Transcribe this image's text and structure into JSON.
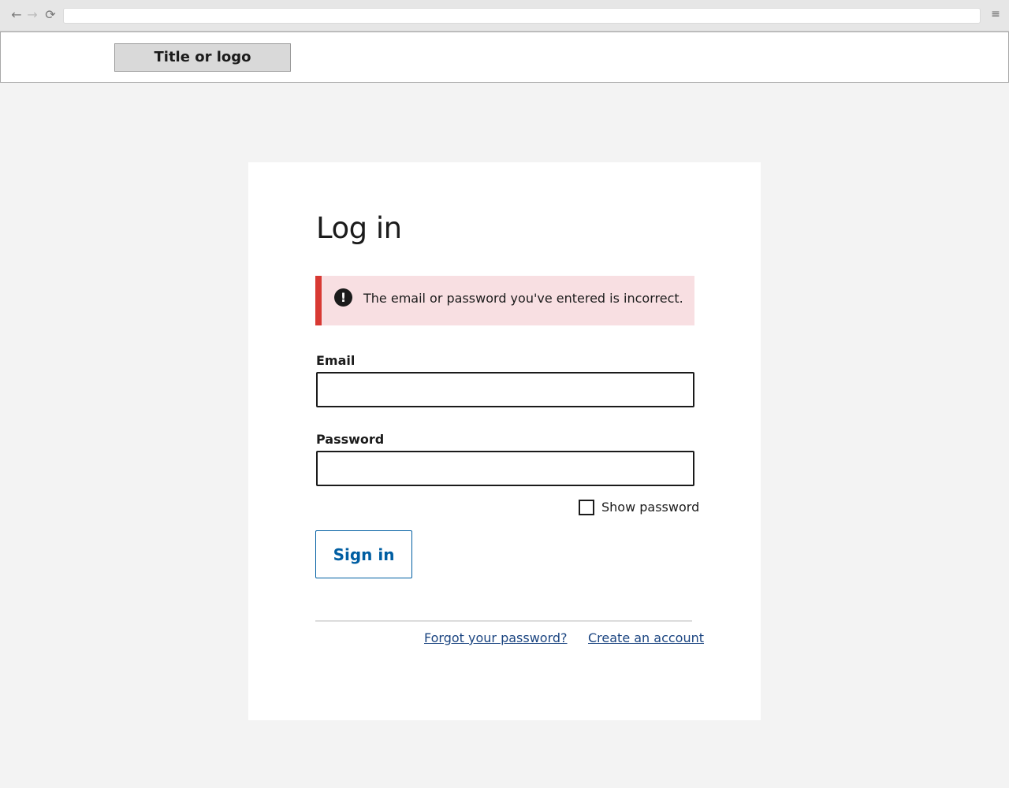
{
  "browser": {
    "back_glyph": "←",
    "forward_glyph": "→",
    "reload_glyph": "⟳",
    "menu_glyph": "≡"
  },
  "header": {
    "logo_text": "Title or logo"
  },
  "form": {
    "title": "Log in",
    "error": {
      "icon_glyph": "!",
      "message": "The email or password you've entered is incorrect.",
      "accent_color": "#d83933",
      "background_color": "#f8dfe2"
    },
    "email": {
      "label": "Email",
      "value": ""
    },
    "password": {
      "label": "Password",
      "value": ""
    },
    "show_password": {
      "label": "Show password",
      "checked": false
    },
    "submit_label": "Sign in",
    "links": {
      "forgot": "Forgot your password?",
      "create": "Create an account"
    }
  },
  "colors": {
    "primary": "#005ea2",
    "link": "#1a4480",
    "page_background": "#f3f3f3"
  }
}
